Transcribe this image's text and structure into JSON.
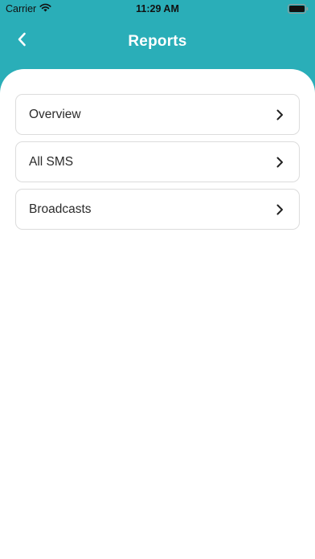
{
  "status_bar": {
    "carrier": "Carrier",
    "time": "11:29 AM",
    "wifi_icon": "wifi-icon",
    "battery_icon": "battery-icon"
  },
  "header": {
    "title": "Reports",
    "back_icon": "chevron-left-icon",
    "background_color": "#2aaeb8"
  },
  "menu": {
    "items": [
      {
        "label": "Overview",
        "icon": "chevron-right-icon"
      },
      {
        "label": "All SMS",
        "icon": "chevron-right-icon"
      },
      {
        "label": "Broadcasts",
        "icon": "chevron-right-icon"
      }
    ]
  }
}
